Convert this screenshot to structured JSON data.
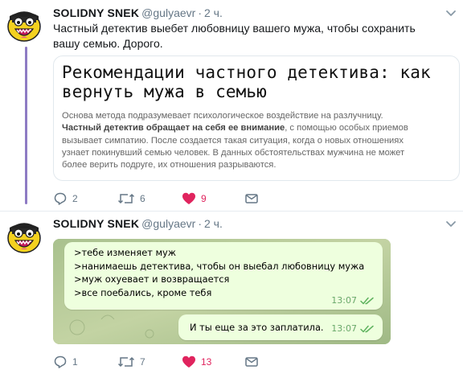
{
  "tweets": [
    {
      "author": "SOLIDNY SNEK",
      "handle": "@gulyaevr",
      "separator": "·",
      "time": "2 ч.",
      "text_line1": "Частный детектив выебет любовницу вашего мужа, чтобы сохранить",
      "text_line2": "вашу семью. Дорого.",
      "card": {
        "title_line1": "Рекомендации частного детектива: как",
        "title_line2": "вернуть мужа в семью",
        "body_line1": "Основа метода подразумевает психологическое воздействие на разлучницу.",
        "body_line2_bold": "Частный детектив обращает на себя ее внимание",
        "body_line2_rest": ", с помощью особых приемов",
        "body_line3": "вызывает симпатию. После создается такая ситуация, когда о новых отношениях",
        "body_line4": "узнает покинувший семью человек. В данных обстоятельствах мужчина не может",
        "body_line5": "более верить подруге, их отношения разрываются."
      },
      "replies": "2",
      "retweets": "6",
      "likes": "9"
    },
    {
      "author": "SOLIDNY SNEK",
      "handle": "@gulyaevr",
      "separator": "·",
      "time": "2 ч.",
      "chat": {
        "message1_lines": [
          ">тебе изменяет муж",
          ">нанимаешь детектива, чтобы он выебал любовницу мужа",
          ">муж охуевает и возвращается",
          ">все поебались, кроме тебя"
        ],
        "message1_time": "13:07",
        "message2": "И ты еще за это заплатила.",
        "message2_time": "13:07"
      },
      "replies": "1",
      "retweets": "7",
      "likes": "13"
    }
  ],
  "colors": {
    "thread_line": "#8e7bc4",
    "like_active": "#e0245e",
    "secondary_text": "#657786",
    "chat_bubble": "#eeffde",
    "chat_background": "#b3c79a"
  },
  "icons": [
    "avatar-cartoon-icon",
    "chevron-down-icon",
    "reply-icon",
    "retweet-icon",
    "heart-icon",
    "direct-message-icon",
    "double-check-icon"
  ]
}
